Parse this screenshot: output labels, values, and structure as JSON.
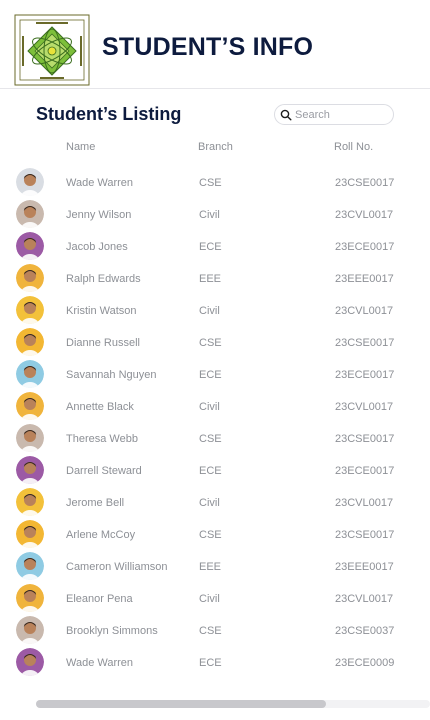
{
  "header": {
    "title": "STUDENT’S INFO",
    "logo_icon": "university-seal-logo"
  },
  "listing": {
    "title": "Student’s Listing",
    "search_placeholder": "Search",
    "columns": {
      "name": "Name",
      "branch": "Branch",
      "roll": "Roll No."
    },
    "rows": [
      {
        "name": "Wade Warren",
        "branch": "CSE",
        "roll": "23CSE0017",
        "avatar_bg": "#d9dde3"
      },
      {
        "name": "Jenny Wilson",
        "branch": "Civil",
        "roll": "23CVL0017",
        "avatar_bg": "#c9b9ae"
      },
      {
        "name": "Jacob Jones",
        "branch": "ECE",
        "roll": "23ECE0017",
        "avatar_bg": "#9c5aa5"
      },
      {
        "name": "Ralph Edwards",
        "branch": "EEE",
        "roll": "23EEE0017",
        "avatar_bg": "#f0b43c"
      },
      {
        "name": "Kristin Watson",
        "branch": "Civil",
        "roll": "23CVL0017",
        "avatar_bg": "#f3c13a"
      },
      {
        "name": "Dianne Russell",
        "branch": "CSE",
        "roll": "23CSE0017",
        "avatar_bg": "#f3b733"
      },
      {
        "name": "Savannah Nguyen",
        "branch": "ECE",
        "roll": "23ECE0017",
        "avatar_bg": "#8fcbe3"
      },
      {
        "name": "Annette Black",
        "branch": "Civil",
        "roll": "23CVL0017",
        "avatar_bg": "#f0b43c"
      },
      {
        "name": "Theresa Webb",
        "branch": "CSE",
        "roll": "23CSE0017",
        "avatar_bg": "#c9b9ae"
      },
      {
        "name": "Darrell Steward",
        "branch": "ECE",
        "roll": "23ECE0017",
        "avatar_bg": "#9c5aa5"
      },
      {
        "name": "Jerome Bell",
        "branch": "Civil",
        "roll": "23CVL0017",
        "avatar_bg": "#f3c13a"
      },
      {
        "name": "Arlene McCoy",
        "branch": "CSE",
        "roll": "23CSE0017",
        "avatar_bg": "#f3b733"
      },
      {
        "name": "Cameron Williamson",
        "branch": "EEE",
        "roll": "23EEE0017",
        "avatar_bg": "#8fcbe3"
      },
      {
        "name": "Eleanor Pena",
        "branch": "Civil",
        "roll": "23CVL0017",
        "avatar_bg": "#f0b43c"
      },
      {
        "name": "Brooklyn Simmons",
        "branch": "CSE",
        "roll": "23CSE0037",
        "avatar_bg": "#c9b9ae"
      },
      {
        "name": "Wade Warren",
        "branch": "ECE",
        "roll": "23ECE0009",
        "avatar_bg": "#9c5aa5"
      }
    ]
  },
  "colors": {
    "title": "#0d1b3e",
    "muted_text": "#8d9096",
    "scroll_thumb": "#c8c8cc"
  }
}
